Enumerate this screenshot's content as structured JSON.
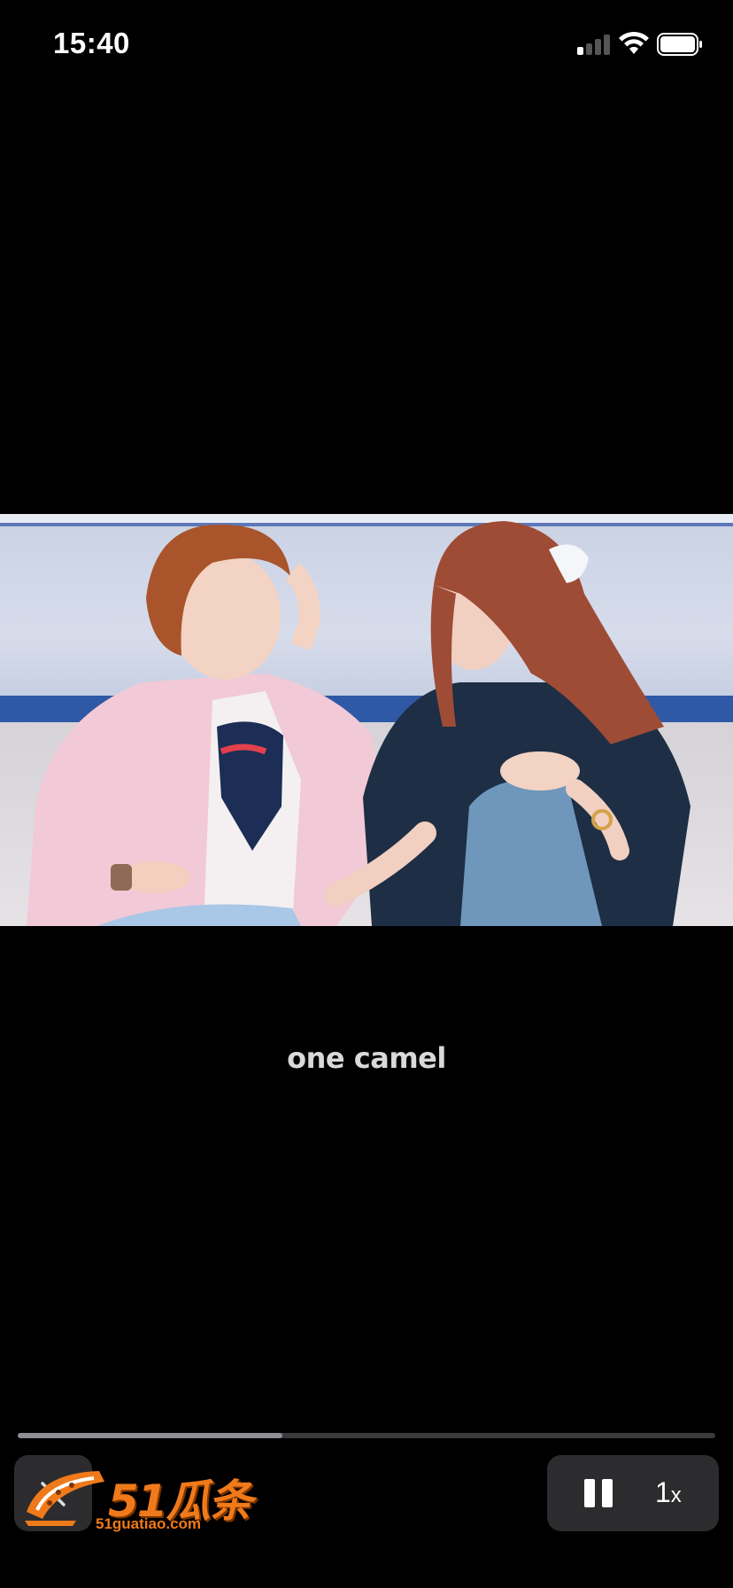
{
  "status_bar": {
    "time": "15:40",
    "signal_icon": "cellular-signal-icon",
    "wifi_icon": "wifi-icon",
    "battery_icon": "battery-icon"
  },
  "video": {
    "subtitle": "one camel",
    "progress": 0.38
  },
  "controls": {
    "close_icon": "close-icon",
    "pause_icon": "pause-icon",
    "speed_label": "1",
    "speed_suffix": "x"
  },
  "watermark": {
    "brand": "51瓜条",
    "url": "51guatiao.com",
    "brand_color": "#f07a1a"
  }
}
